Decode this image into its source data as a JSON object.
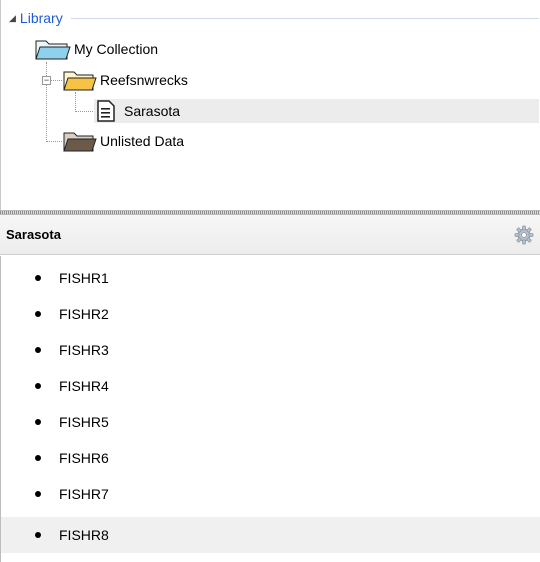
{
  "tree": {
    "root_label": "Library",
    "nodes": {
      "my_collection": "My Collection",
      "reefsnwrecks": "Reefsnwrecks",
      "sarasota": "Sarasota",
      "unlisted": "Unlisted Data"
    },
    "expander_symbol": "−"
  },
  "details": {
    "title": "Sarasota",
    "gear_icon": "gear-icon"
  },
  "list": {
    "items": [
      "FISHR1",
      "FISHR2",
      "FISHR3",
      "FISHR4",
      "FISHR5",
      "FISHR6",
      "FISHR7",
      "FISHR8"
    ]
  },
  "colors": {
    "library_blue": "#1e5bd8",
    "folder_yellow": "#f6c344",
    "folder_blue": "#8fd0ec",
    "folder_dark": "#6b5a4a"
  }
}
